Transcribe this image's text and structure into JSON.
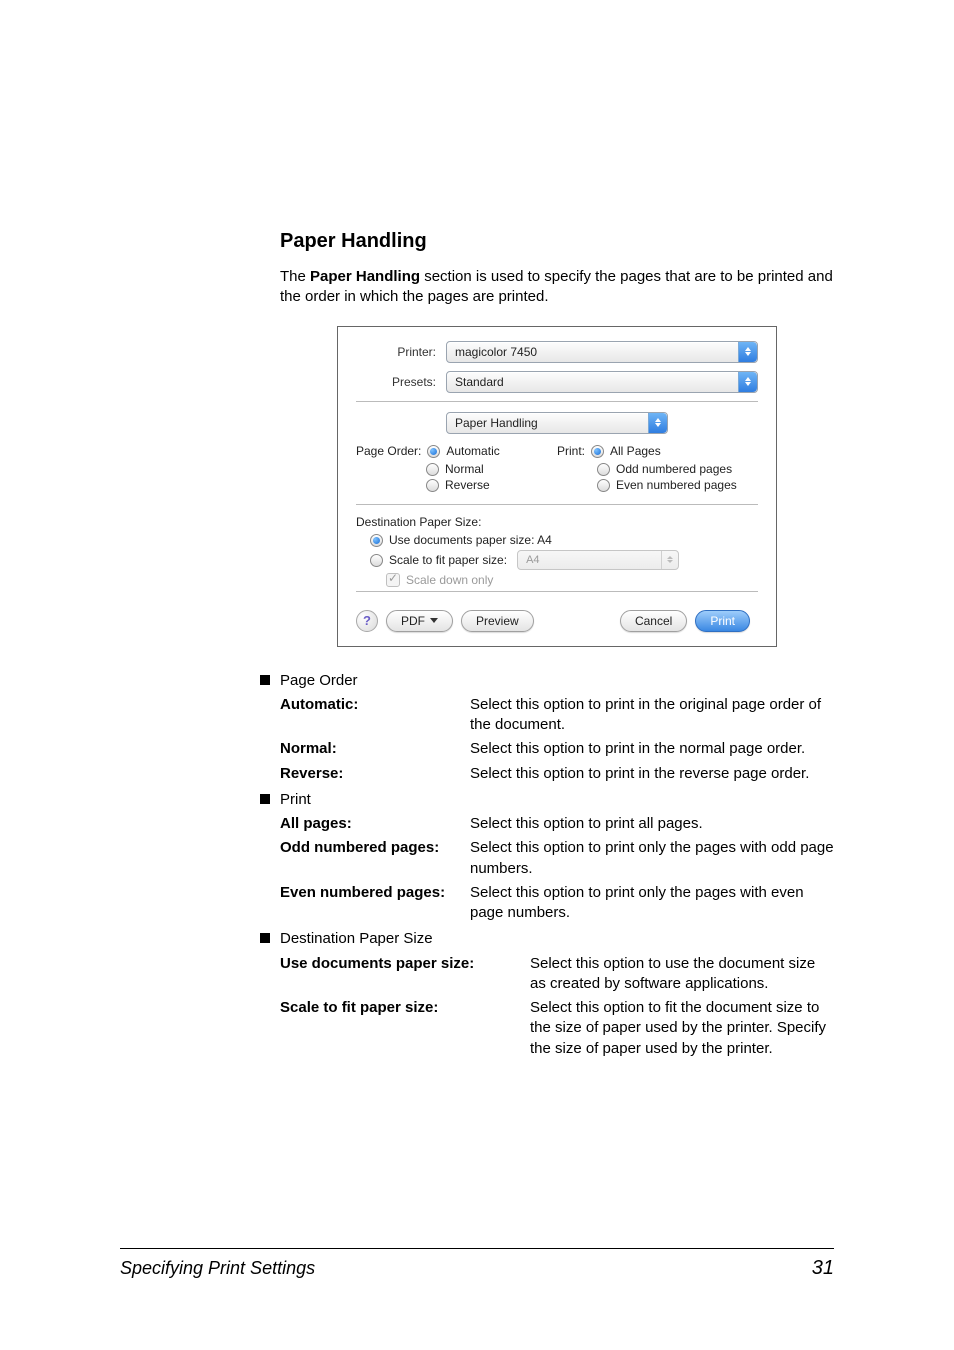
{
  "heading": "Paper Handling",
  "intro_prefix": "The ",
  "intro_bold": "Paper Handling",
  "intro_suffix": " section is used to specify the pages that are to be printed and the order in which the pages are printed.",
  "dialog": {
    "printer_label": "Printer:",
    "printer_value": "magicolor 7450",
    "presets_label": "Presets:",
    "presets_value": "Standard",
    "panel_value": "Paper Handling",
    "page_order_label": "Page Order:",
    "page_order": {
      "automatic": "Automatic",
      "normal": "Normal",
      "reverse": "Reverse"
    },
    "print_label": "Print:",
    "print": {
      "all": "All Pages",
      "odd": "Odd numbered pages",
      "even": "Even numbered pages"
    },
    "dest_title": "Destination Paper Size:",
    "use_doc": "Use documents paper size:  A4",
    "scale_fit": "Scale to fit paper size:",
    "scale_fit_value": "A4",
    "scale_down": "Scale down only",
    "help": "?",
    "pdf_btn": "PDF",
    "preview_btn": "Preview",
    "cancel_btn": "Cancel",
    "print_btn": "Print"
  },
  "sections": {
    "page_order_title": "Page Order",
    "auto_term": "Automatic",
    "auto_desc": "Select this option to print in the original page order of the document.",
    "normal_term": "Normal",
    "normal_desc": "Select this option to print in the normal page order.",
    "reverse_term": "Reverse",
    "reverse_desc": "Select this option to print in the reverse page order.",
    "print_title": "Print",
    "all_term": "All pages",
    "all_desc": "Select this option to print all pages.",
    "odd_term": "Odd numbered pages",
    "odd_desc": "Select this option to print only the pages with odd page numbers.",
    "even_term": "Even numbered pages",
    "even_desc": "Select this option to print only the pages with even page numbers.",
    "dest_title": "Destination Paper Size",
    "use_term": "Use documents paper size",
    "use_desc": "Select this option to use the document size as created by software applications.",
    "scale_term": "Scale to fit paper size",
    "scale_desc": "Select this option to fit the document size to the size of paper used by the printer. Specify the size of paper used by the printer."
  },
  "footer": {
    "title": "Specifying Print Settings",
    "page": "31"
  },
  "colon": ":"
}
